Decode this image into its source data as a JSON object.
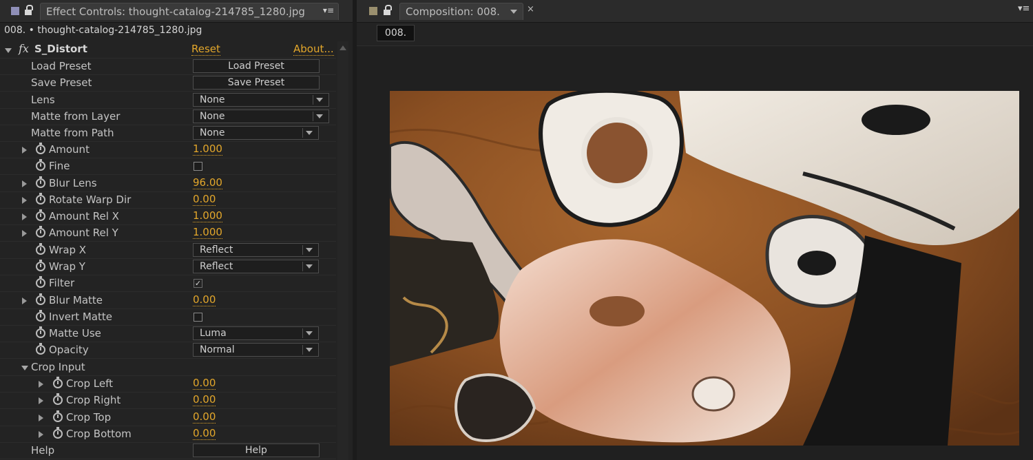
{
  "effect_controls": {
    "tab_title": "Effect Controls: thought-catalog-214785_1280.jpg",
    "tab_menu_glyph": "▾≡",
    "layer_line": "008. • thought-catalog-214785_1280.jpg",
    "effect": {
      "name": "S_Distort",
      "fx_glyph": "fx",
      "reset_label": "Reset",
      "about_label": "About..."
    },
    "rows": {
      "load_preset": {
        "label": "Load Preset",
        "button": "Load Preset"
      },
      "save_preset": {
        "label": "Save Preset",
        "button": "Save Preset"
      },
      "lens": {
        "label": "Lens",
        "value": "None"
      },
      "matte_from_layer": {
        "label": "Matte from Layer",
        "value": "None"
      },
      "matte_from_path": {
        "label": "Matte from Path",
        "value": "None"
      },
      "amount": {
        "label": "Amount",
        "value": "1.000"
      },
      "fine": {
        "label": "Fine",
        "checked": false
      },
      "blur_lens": {
        "label": "Blur Lens",
        "value": "96.00"
      },
      "rotate_warp_dir": {
        "label": "Rotate Warp Dir",
        "value": "0.00"
      },
      "amount_rel_x": {
        "label": "Amount Rel X",
        "value": "1.000"
      },
      "amount_rel_y": {
        "label": "Amount Rel Y",
        "value": "1.000"
      },
      "wrap_x": {
        "label": "Wrap X",
        "value": "Reflect"
      },
      "wrap_y": {
        "label": "Wrap Y",
        "value": "Reflect"
      },
      "filter": {
        "label": "Filter",
        "checked": true,
        "check_glyph": "✓"
      },
      "blur_matte": {
        "label": "Blur Matte",
        "value": "0.00"
      },
      "invert_matte": {
        "label": "Invert Matte",
        "checked": false
      },
      "matte_use": {
        "label": "Matte Use",
        "value": "Luma"
      },
      "opacity": {
        "label": "Opacity",
        "value": "Normal"
      },
      "crop_input": {
        "label": "Crop Input"
      },
      "crop_left": {
        "label": "Crop Left",
        "value": "0.00"
      },
      "crop_right": {
        "label": "Crop Right",
        "value": "0.00"
      },
      "crop_top": {
        "label": "Crop Top",
        "value": "0.00"
      },
      "crop_bottom": {
        "label": "Crop Bottom",
        "value": "0.00"
      },
      "help": {
        "label": "Help",
        "button": "Help"
      }
    }
  },
  "composition": {
    "tab_title": "Composition: 008.",
    "close_glyph": "×",
    "menu_glyph": "▾≡",
    "chip_label": "008."
  },
  "colors": {
    "accent_value": "#e3a72b",
    "panel_bg": "#232323",
    "wood_base": "#8a4f22",
    "cream": "#e7e0d6"
  },
  "icons": {
    "panel_square": "square-icon",
    "lock": "lock-icon",
    "stopwatch": "stopwatch-icon",
    "fx": "fx-icon",
    "twirl": "triangle-icon"
  }
}
